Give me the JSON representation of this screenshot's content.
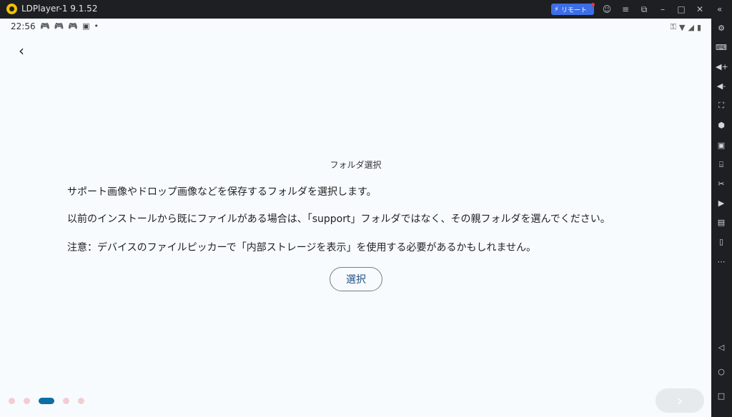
{
  "titlebar": {
    "title": "LDPlayer-1 9.1.52",
    "remote_label": "リモート",
    "icons": [
      "account-icon",
      "menu-icon",
      "restore-icon",
      "minimize-icon",
      "maximize-icon",
      "close-icon",
      "collapse-icon"
    ]
  },
  "statusbar": {
    "time": "22:56",
    "left_icons": [
      "gamepad-icon",
      "gamepad-icon",
      "gamepad-icon",
      "app-icon",
      "dot-icon"
    ],
    "right_icons": [
      "key-icon",
      "wifi-icon",
      "signal-icon",
      "battery-icon"
    ]
  },
  "page": {
    "heading": "フォルダ選択",
    "para1": "サポート画像やドロップ画像などを保存するフォルダを選択します。",
    "para2": "以前のインストールから既にファイルがある場合は、「support」フォルダではなく、その親フォルダを選んでください。",
    "para3": "注意：デバイスのファイルピッカーで「内部ストレージを表示」を使用する必要があるかもしれません。",
    "select_button": "選択",
    "pager": {
      "count": 5,
      "active_index": 2
    },
    "next_glyph": "›"
  },
  "sidebar": {
    "icons": [
      "settings-icon",
      "keyboard-map-icon",
      "volume-up-icon",
      "volume-down-icon",
      "screenshot-icon",
      "apk-install-icon",
      "record-icon",
      "keyboard-icon",
      "scissors-icon",
      "video-icon",
      "sync-icon",
      "phone-icon",
      "more-icon",
      "back-nav-icon",
      "home-nav-icon",
      "recents-nav-icon"
    ]
  },
  "colors": {
    "accent": "#0e6ea6",
    "button_text": "#1e4f86",
    "remote_bg": "#3d6ee8"
  }
}
